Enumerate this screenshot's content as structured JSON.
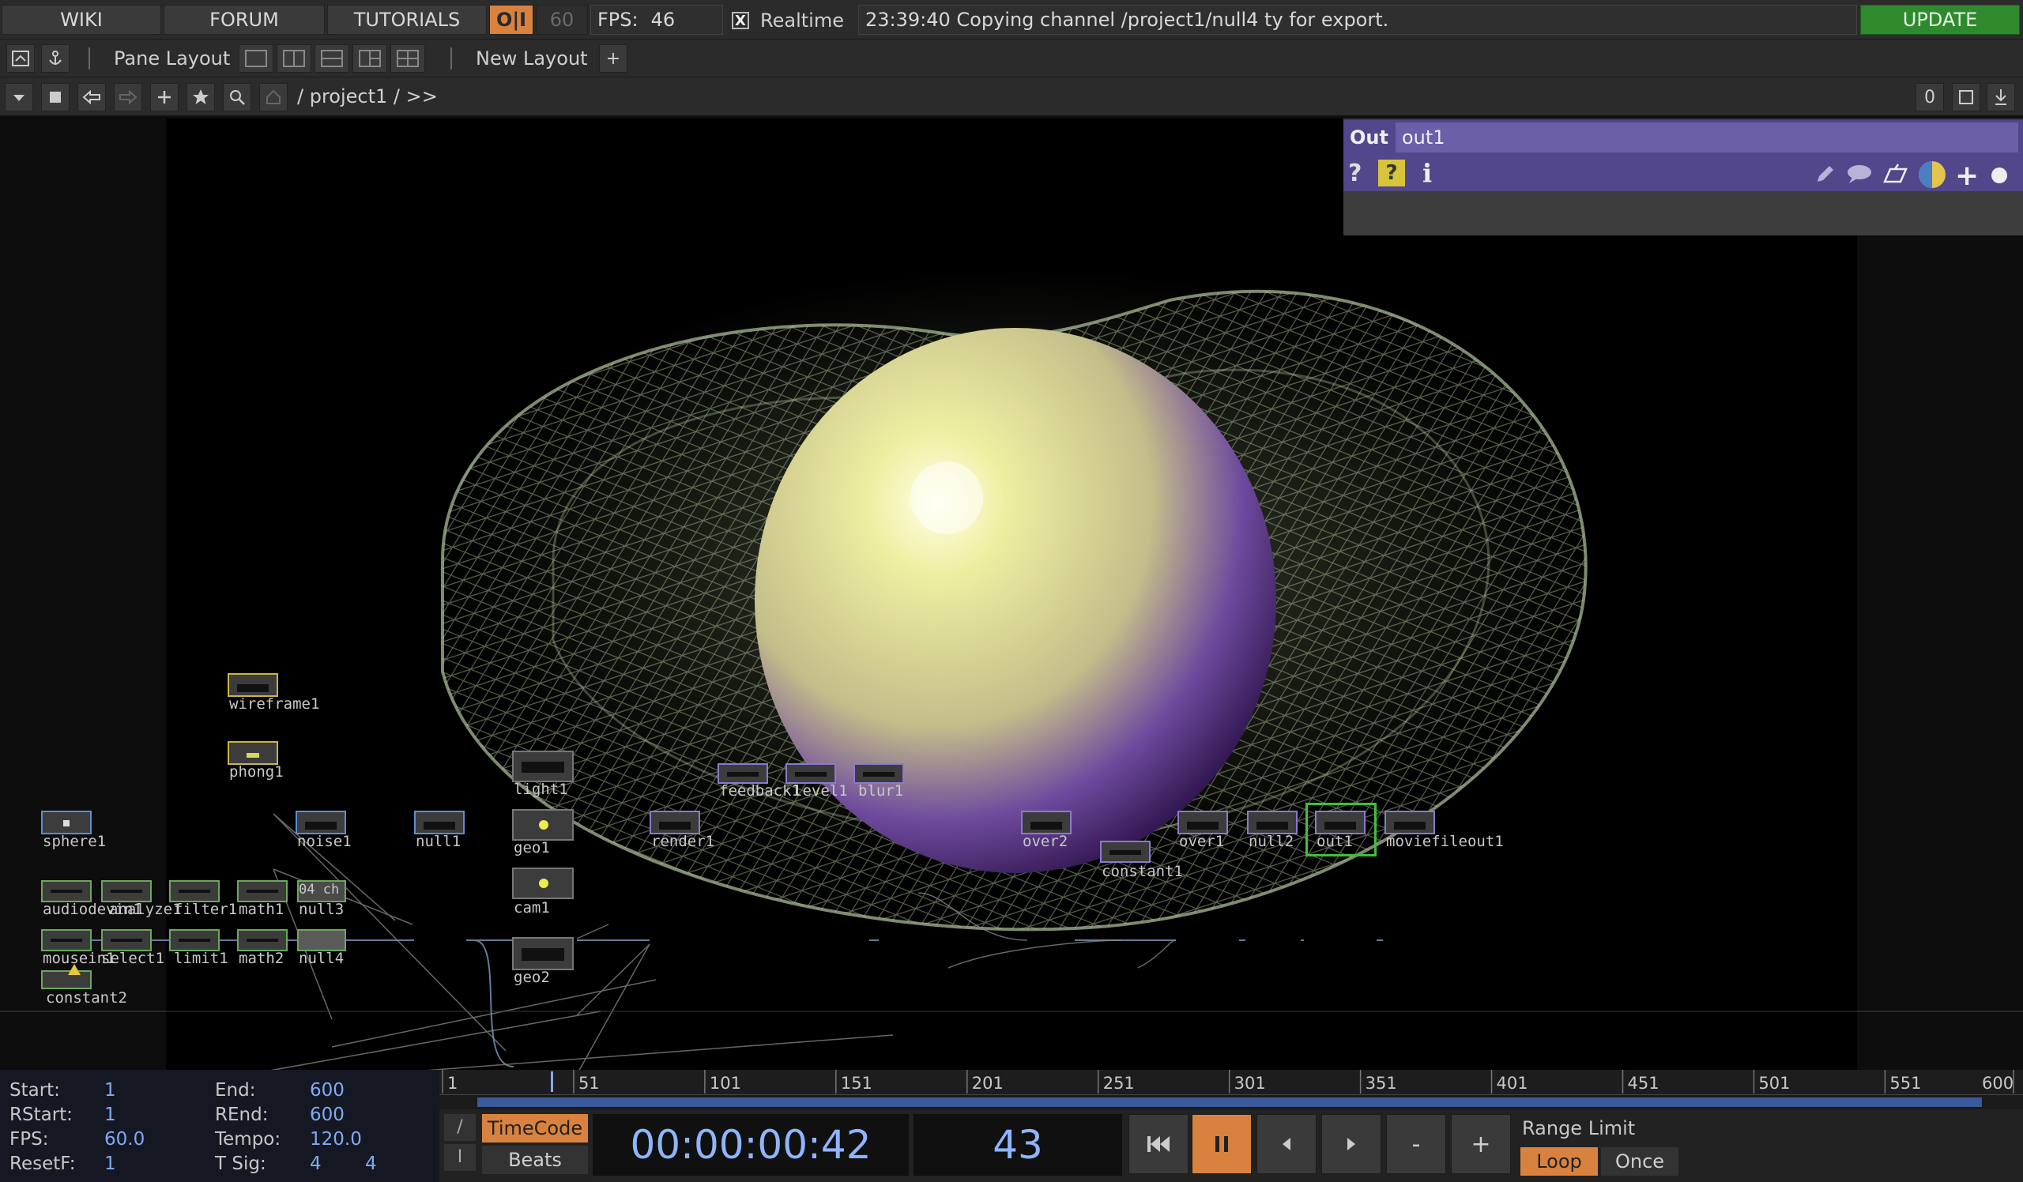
{
  "topbar": {
    "wiki": "WIKI",
    "forum": "FORUM",
    "tutorials": "TUTORIALS",
    "perf_toggle": "O|I",
    "fps_target": "60",
    "fps_label": "FPS:",
    "fps_value": "46",
    "realtime_check": "X",
    "realtime_label": "Realtime",
    "status_message": "23:39:40 Copying channel /project1/null4 ty for export.",
    "update": "UPDATE"
  },
  "layoutbar": {
    "pane_layout": "Pane Layout",
    "new_layout": "New Layout",
    "plus": "+"
  },
  "pathbar": {
    "path_root": "/ project1 / >>",
    "counter": "0"
  },
  "nodes": {
    "wireframe1": "wireframe1",
    "phong1": "phong1",
    "sphere1": "sphere1",
    "noise1": "noise1",
    "null1": "null1",
    "light1": "light1",
    "geo1": "geo1",
    "cam1": "cam1",
    "geo2": "geo2",
    "render1": "render1",
    "feedback1": "feedback1",
    "level1": "level1",
    "blur1": "blur1",
    "over2": "over2",
    "constant1": "constant1",
    "over1": "over1",
    "null2": "null2",
    "out1": "out1",
    "moviefileout1": "moviefileout1",
    "audiodevin": "audiodevin1",
    "analyze1": "analyze1",
    "filter1": "filter1",
    "math1": "math1",
    "null3": "null3",
    "null3_chan": "04 ch",
    "mousein": "mousein1",
    "select1": "select1",
    "limit1": "limit1",
    "math2": "math2",
    "null4": "null4",
    "constant2": "constant2"
  },
  "infopanel": {
    "type": "Out",
    "name": "out1"
  },
  "timeline": {
    "ticks": [
      "1",
      "51",
      "101",
      "151",
      "201",
      "251",
      "301",
      "351",
      "401",
      "451",
      "501",
      "551",
      "600"
    ],
    "playhead": 43
  },
  "bottom": {
    "start_label": "Start:",
    "start_val": "1",
    "end_label": "End:",
    "end_val": "600",
    "rstart_label": "RStart:",
    "rstart_val": "1",
    "rend_label": "REnd:",
    "rend_val": "600",
    "fps_label": "FPS:",
    "fps_val": "60.0",
    "tempo_label": "Tempo:",
    "tempo_val": "120.0",
    "resetf_label": "ResetF:",
    "resetf_val": "1",
    "tsig_label": "T Sig:",
    "tsig_a": "4",
    "tsig_b": "4",
    "slash": "/",
    "bar_i": "I",
    "timecode": "TimeCode",
    "beats": "Beats",
    "time": "00:00:00:42",
    "frame": "43",
    "range_limit": "Range Limit",
    "loop": "Loop",
    "once": "Once",
    "minus": "-",
    "plus": "+"
  },
  "colors": {
    "accent_orange": "#d9823f",
    "update_green": "#2f8a2e",
    "info_purple": "#51478a",
    "value_blue": "#7faaf5"
  }
}
